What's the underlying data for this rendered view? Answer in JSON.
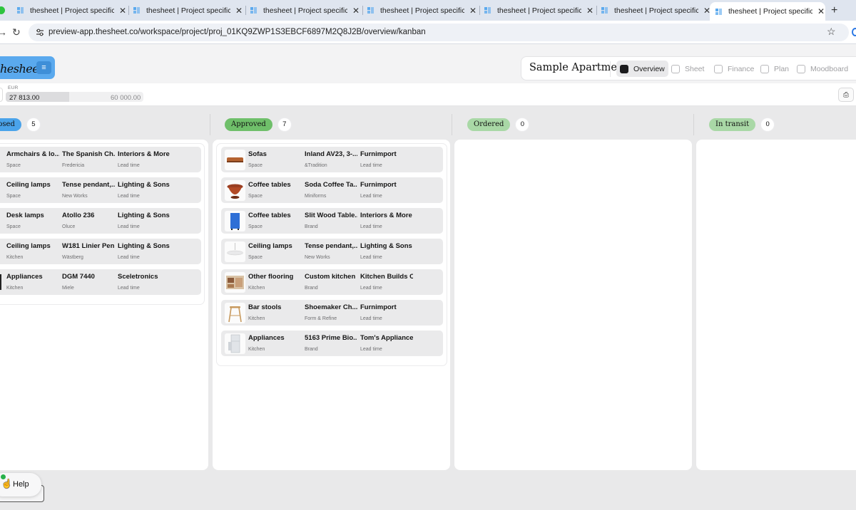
{
  "browser": {
    "tabs": [
      {
        "title": "thesheet | Project specificat"
      },
      {
        "title": "thesheet | Project specificat"
      },
      {
        "title": "thesheet | Project specificat"
      },
      {
        "title": "thesheet | Project specificat"
      },
      {
        "title": "thesheet | Project specificat"
      },
      {
        "title": "thesheet | Project specificat"
      },
      {
        "title": "thesheet | Project specificat"
      }
    ],
    "close_glyph": "✕",
    "new_tab_glyph": "+",
    "url": "preview-app.thesheet.co/workspace/project/proj_01KQ9ZWP1S3EBCF6897M2Q8J2B/overview/kanban"
  },
  "header": {
    "logo": "hesheet",
    "menu_glyph": "≡",
    "project_name": "Sample Apartment",
    "views": [
      {
        "label": "Overview",
        "active": true
      },
      {
        "label": "Sheet",
        "active": false
      },
      {
        "label": "Finance",
        "active": false
      },
      {
        "label": "Plan",
        "active": false
      },
      {
        "label": "Moodboard",
        "active": false
      }
    ]
  },
  "budget": {
    "currency": "EUR",
    "spent": "27 813.00",
    "total": "60 000.00",
    "progress": 0.4635
  },
  "columns": [
    {
      "status": "posed",
      "count": "5",
      "pill_color": "#4aa3ea",
      "cards": [
        {
          "name": "Armchairs & lo...",
          "location": "Space",
          "product": "The Spanish Ch...",
          "brand": "Fredericia",
          "supplier": "Interiors & More",
          "lead": "Lead time"
        },
        {
          "name": "Ceiling lamps",
          "location": "Space",
          "product": "Tense pendant,...",
          "brand": "New Works",
          "supplier": "Lighting & Sons",
          "lead": "Lead time"
        },
        {
          "name": "Desk lamps",
          "location": "Space",
          "product": "Atollo 236",
          "brand": "Oluce",
          "supplier": "Lighting & Sons",
          "lead": "Lead time"
        },
        {
          "name": "Ceiling lamps",
          "location": "Kitchen",
          "product": "W181 Linier Pen...",
          "brand": "Wästberg",
          "supplier": "Lighting & Sons",
          "lead": "Lead time"
        },
        {
          "name": "Appliances",
          "location": "Kitchen",
          "product": "DGM 7440",
          "brand": "Miele",
          "supplier": "Sceletronics",
          "lead": "Lead time"
        }
      ]
    },
    {
      "status": "Approved",
      "count": "7",
      "pill_color": "#6fbf6a",
      "cards": [
        {
          "name": "Sofas",
          "location": "Space",
          "product": "Inland AV23, 3-...",
          "brand": "&Tradition",
          "supplier": "Furnimport",
          "lead": "Lead time",
          "thumb": "sofa"
        },
        {
          "name": "Coffee tables",
          "location": "Space",
          "product": "Soda Coffee Ta...",
          "brand": "Miniforms",
          "supplier": "Furnimport",
          "lead": "Lead time",
          "thumb": "bowl-table"
        },
        {
          "name": "Coffee tables",
          "location": "Space",
          "product": "Slit Wood Table...",
          "brand": "Brand",
          "supplier": "Interiors & More",
          "lead": "Lead time",
          "thumb": "blue-cabinet"
        },
        {
          "name": "Ceiling lamps",
          "location": "Space",
          "product": "Tense pendant,...",
          "brand": "New Works",
          "supplier": "Lighting & Sons",
          "lead": "Lead time",
          "thumb": "pendant"
        },
        {
          "name": "Other flooring",
          "location": "Kitchen",
          "product": "Custom kitchen",
          "brand": "Brand",
          "supplier": "Kitchen Builds Co",
          "lead": "Lead time",
          "thumb": "kitchen"
        },
        {
          "name": "Bar stools",
          "location": "Kitchen",
          "product": "Shoemaker Ch...",
          "brand": "Form & Refine",
          "supplier": "Furnimport",
          "lead": "Lead time",
          "thumb": "stool"
        },
        {
          "name": "Appliances",
          "location": "Kitchen",
          "product": "5163 Prime Bio...",
          "brand": "Brand",
          "supplier": "Tom's Appliances",
          "lead": "Lead time",
          "thumb": "fridge"
        }
      ]
    },
    {
      "status": "Ordered",
      "count": "0",
      "pill_color": "#a9d8a6",
      "cards": []
    },
    {
      "status": "In transit",
      "count": "0",
      "pill_color": "#a9d8a6",
      "cards": []
    }
  ],
  "help": {
    "label": "Help"
  }
}
